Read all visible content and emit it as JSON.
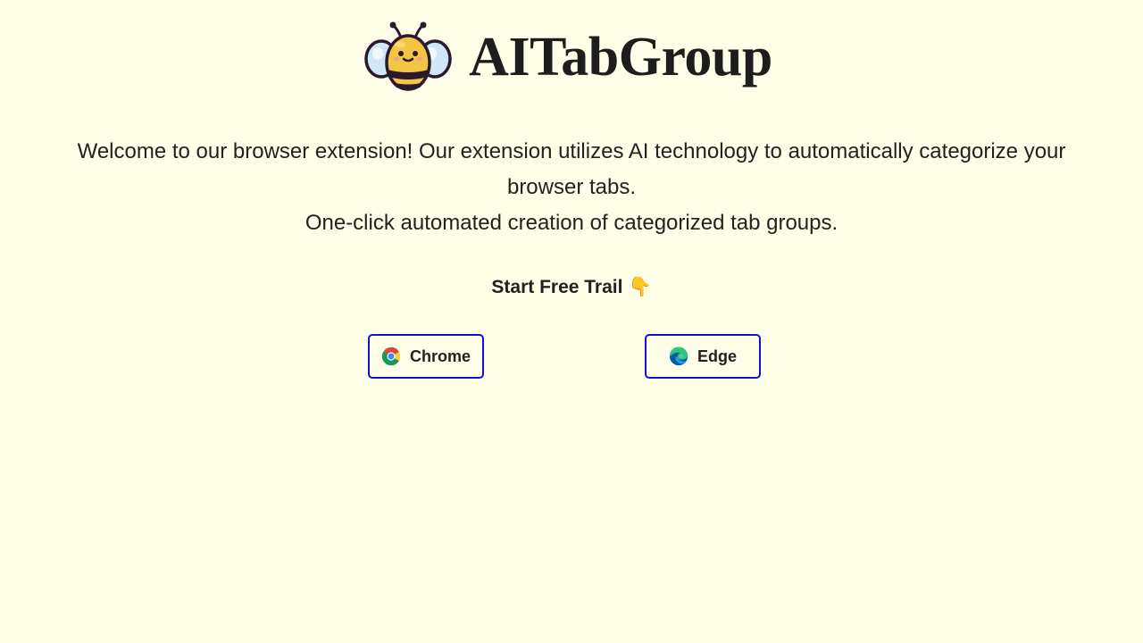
{
  "header": {
    "title": "AITabGroup",
    "logo_icon": "bee-icon"
  },
  "description": {
    "line1": "Welcome to our browser extension! Our extension utilizes AI technology to automatically categorize your browser tabs.",
    "line2": "One-click automated creation of categorized tab groups."
  },
  "cta": {
    "label": "Start Free Trail",
    "emoji": "👇"
  },
  "buttons": {
    "chrome": {
      "label": "Chrome",
      "icon": "chrome-icon"
    },
    "edge": {
      "label": "Edge",
      "icon": "edge-icon"
    }
  },
  "colors": {
    "background": "#fefee9",
    "button_border": "#1212c9",
    "text": "#222222"
  }
}
